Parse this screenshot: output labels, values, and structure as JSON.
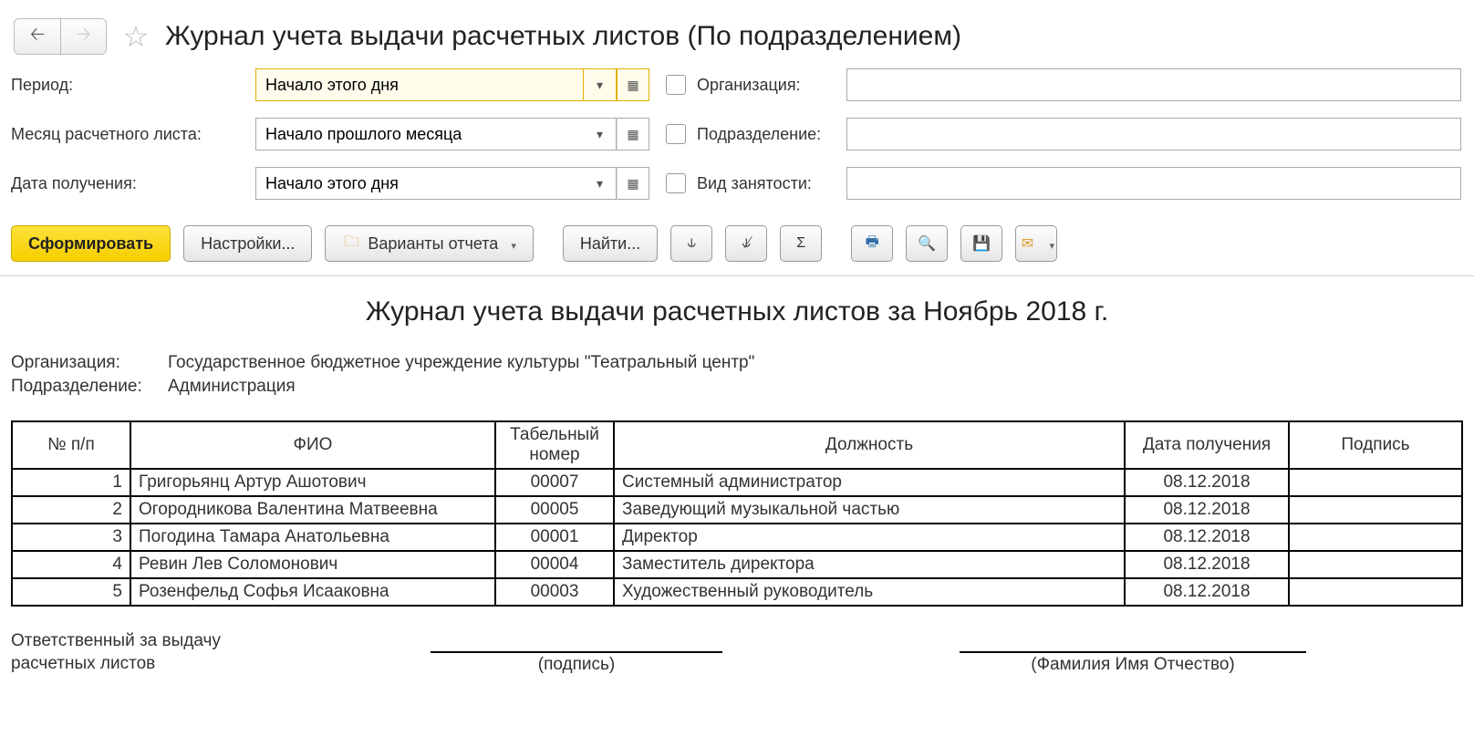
{
  "header": {
    "title": "Журнал учета выдачи расчетных листов (По подразделением)"
  },
  "filters": {
    "period_label": "Период:",
    "period_value": "Начало этого дня",
    "month_label": "Месяц расчетного листа:",
    "month_value": "Начало прошлого месяца",
    "receive_label": "Дата получения:",
    "receive_value": "Начало этого дня",
    "org_label": "Организация:",
    "org_value": "",
    "dept_label": "Подразделение:",
    "dept_value": "",
    "empl_label": "Вид занятости:",
    "empl_value": ""
  },
  "toolbar": {
    "generate": "Сформировать",
    "settings": "Настройки...",
    "variants": "Варианты отчета",
    "find": "Найти..."
  },
  "report": {
    "title": "Журнал учета выдачи расчетных листов за Ноябрь 2018 г.",
    "org_label": "Организация:",
    "org_value": "Государственное бюджетное учреждение культуры \"Театральный центр\"",
    "dept_label": "Подразделение:",
    "dept_value": "Администрация",
    "columns": {
      "num": "№ п/п",
      "fio": "ФИО",
      "tab": "Табельный номер",
      "pos": "Должность",
      "date": "Дата получения",
      "sign": "Подпись"
    },
    "rows": [
      {
        "num": "1",
        "fio": "Григорьянц Артур Ашотович",
        "tab": "00007",
        "pos": "Системный администратор",
        "date": "08.12.2018",
        "sign": ""
      },
      {
        "num": "2",
        "fio": "Огородникова Валентина Матвеевна",
        "tab": "00005",
        "pos": "Заведующий музыкальной частью",
        "date": "08.12.2018",
        "sign": ""
      },
      {
        "num": "3",
        "fio": "Погодина Тамара Анатольевна",
        "tab": "00001",
        "pos": "Директор",
        "date": "08.12.2018",
        "sign": ""
      },
      {
        "num": "4",
        "fio": "Ревин Лев Соломонович",
        "tab": "00004",
        "pos": "Заместитель директора",
        "date": "08.12.2018",
        "sign": ""
      },
      {
        "num": "5",
        "fio": "Розенфельд Софья Исааковна",
        "tab": "00003",
        "pos": "Художественный руководитель",
        "date": "08.12.2018",
        "sign": ""
      }
    ],
    "responsible_label": "Ответственный за выдачу расчетных листов",
    "sig1": "(подпись)",
    "sig2": "(Фамилия Имя Отчество)"
  }
}
